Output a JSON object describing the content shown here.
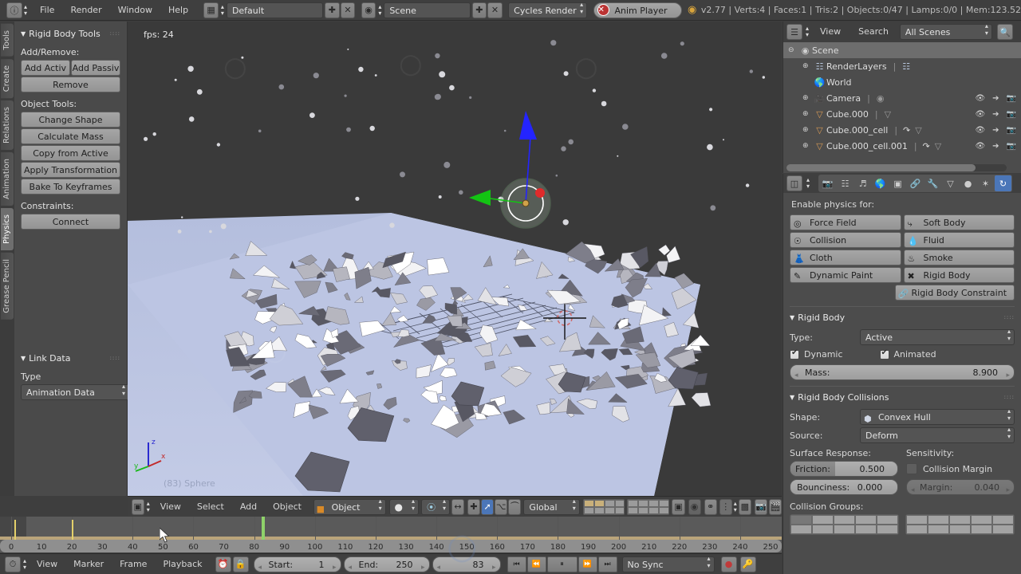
{
  "topbar": {
    "editor_icon": "info-editor-icon",
    "menus": [
      "File",
      "Render",
      "Window",
      "Help"
    ],
    "screen_layout": {
      "icon": "screen-layout-icon",
      "value": "Default",
      "add": "+",
      "remove": "×"
    },
    "scene": {
      "icon": "scene-icon",
      "value": "Scene",
      "add": "+",
      "remove": "×"
    },
    "engine": {
      "value": "Cycles Render"
    },
    "anim_player": {
      "label": "Anim Player",
      "close": "×"
    },
    "status": "v2.77 | Verts:4 | Faces:1 | Tris:2 | Objects:0/47 | Lamps:0/0 | Mem:123.52"
  },
  "toolshelf": {
    "tabs": [
      {
        "label": "Tools",
        "active": false
      },
      {
        "label": "Create",
        "active": false
      },
      {
        "label": "Relations",
        "active": false
      },
      {
        "label": "Animation",
        "active": false
      },
      {
        "label": "Physics",
        "active": true
      },
      {
        "label": "Grease Pencil",
        "active": false
      }
    ],
    "panel_rigid_body_tools": {
      "title": "Rigid Body Tools",
      "sections": [
        {
          "label": "Add/Remove:",
          "rows": [
            [
              "Add Activ",
              "Add Passiv"
            ],
            [
              "Remove"
            ]
          ]
        },
        {
          "label": "Object Tools:",
          "rows": [
            [
              "Change Shape"
            ],
            [
              "Calculate Mass"
            ],
            [
              "Copy from Active"
            ],
            [
              "Apply Transformation"
            ],
            [
              "Bake To Keyframes"
            ]
          ]
        },
        {
          "label": "Constraints:",
          "rows": [
            [
              "Connect"
            ]
          ]
        }
      ]
    },
    "panel_link_data": {
      "title": "Link Data",
      "type_label": "Type",
      "type_value": "Animation Data"
    }
  },
  "viewport": {
    "fps": "fps: 24",
    "active_object_label": "(83) Sphere",
    "axis_gizmo": {
      "x": "x",
      "y": "y",
      "z": "z"
    },
    "colors": {
      "ground": "#b9c2e0",
      "background": "#3a3a3a",
      "debris_light": "#f2f2f2",
      "debris_dark": "#6e6e78"
    },
    "header": {
      "editor_icon": "3d-view-editor-icon",
      "menus": [
        "View",
        "Select",
        "Add",
        "Object"
      ],
      "mode": "Object Mode",
      "shading": "solid-shading-icon",
      "pivot": "pivot-median-icon",
      "manipulator_axes": [
        "translate-manipulator-icon",
        "rotate-manipulator-icon",
        "scale-manipulator-icon"
      ],
      "transform_orientation": "Global",
      "layers": "layer-grid",
      "extras": [
        "render-opengl-icon",
        "render-opengl-anim-icon"
      ]
    }
  },
  "outliner": {
    "header": {
      "editor_icon": "outliner-editor-icon",
      "menus": [
        "View",
        "Search"
      ],
      "display_mode": "All Scenes",
      "search_icon": "search-icon"
    },
    "rows": [
      {
        "indent": 0,
        "expander": "⊖",
        "icon": "scene-icon",
        "label": "Scene",
        "selected": true,
        "extra": [],
        "actions": false
      },
      {
        "indent": 1,
        "expander": "⊕",
        "icon": "renderlayers-icon",
        "label": "RenderLayers",
        "selected": false,
        "extra": [
          "renderlayers-data-icon"
        ],
        "actions": false
      },
      {
        "indent": 1,
        "expander": "",
        "icon": "world-icon",
        "label": "World",
        "selected": false,
        "extra": [],
        "actions": false
      },
      {
        "indent": 1,
        "expander": "⊕",
        "icon": "camera-icon",
        "label": "Camera",
        "selected": false,
        "extra": [
          "camera-data-icon"
        ],
        "actions": true
      },
      {
        "indent": 1,
        "expander": "⊕",
        "icon": "mesh-icon",
        "label": "Cube.000",
        "selected": false,
        "extra": [
          "mesh-data-icon"
        ],
        "actions": true
      },
      {
        "indent": 1,
        "expander": "⊕",
        "icon": "mesh-icon",
        "label": "Cube.000_cell",
        "selected": false,
        "extra": [
          "modifier-icon",
          "mesh-data-icon"
        ],
        "actions": true
      },
      {
        "indent": 1,
        "expander": "⊕",
        "icon": "mesh-icon",
        "label": "Cube.000_cell.001",
        "selected": false,
        "extra": [
          "modifier-icon",
          "mesh-data-icon"
        ],
        "actions": true
      }
    ],
    "row_actions": [
      "eye-icon",
      "cursor-arrow-icon",
      "camera-render-icon"
    ]
  },
  "properties": {
    "header": {
      "editor_icon": "properties-editor-icon",
      "tabs": [
        {
          "name": "render-tab",
          "icon": "📷",
          "active": false
        },
        {
          "name": "render-layers-tab",
          "icon": "❐",
          "active": false
        },
        {
          "name": "scene-tab",
          "icon": "♪",
          "active": false
        },
        {
          "name": "world-tab",
          "icon": "◐",
          "active": false
        },
        {
          "name": "object-tab",
          "icon": "⬛",
          "active": false
        },
        {
          "name": "constraints-tab",
          "icon": "⚭",
          "active": false
        },
        {
          "name": "modifiers-tab",
          "icon": "🔧",
          "active": false
        },
        {
          "name": "data-tab",
          "icon": "▽",
          "active": false
        },
        {
          "name": "material-tab",
          "icon": "●",
          "active": false
        },
        {
          "name": "texture-tab",
          "icon": "✦",
          "active": false
        },
        {
          "name": "physics-tab",
          "icon": "↻",
          "active": true
        }
      ]
    },
    "enable_physics_label": "Enable physics for:",
    "physics_buttons": [
      {
        "label": "Force Field",
        "icon": "force-field-icon"
      },
      {
        "label": "Soft Body",
        "icon": "soft-body-icon"
      },
      {
        "label": "Collision",
        "icon": "collision-icon"
      },
      {
        "label": "Fluid",
        "icon": "fluid-icon"
      },
      {
        "label": "Cloth",
        "icon": "cloth-icon"
      },
      {
        "label": "Smoke",
        "icon": "smoke-icon"
      },
      {
        "label": "Dynamic Paint",
        "icon": "dynamic-paint-icon"
      },
      {
        "label": "Rigid Body",
        "icon": "rigid-body-icon"
      }
    ],
    "rigid_body_constraint_button": {
      "label": "Rigid Body Constraint",
      "icon": "constraint-icon"
    },
    "rigid_body": {
      "title": "Rigid Body",
      "type_label": "Type:",
      "type_value": "Active",
      "dynamic": {
        "label": "Dynamic",
        "checked": true
      },
      "animated": {
        "label": "Animated",
        "checked": true
      },
      "mass_label": "Mass:",
      "mass_value": "8.900"
    },
    "rigid_body_collisions": {
      "title": "Rigid Body Collisions",
      "shape_label": "Shape:",
      "shape_value": "Convex Hull",
      "shape_icon": "convex-hull-icon",
      "source_label": "Source:",
      "source_value": "Deform",
      "surface_response_label": "Surface Response:",
      "sensitivity_label": "Sensitivity:",
      "friction_label": "Friction:",
      "friction_value": "0.500",
      "bounciness_label": "Bounciness:",
      "bounciness_value": "0.000",
      "collision_margin": {
        "label": "Collision Margin",
        "checked": false
      },
      "margin_label": "Margin:",
      "margin_value": "0.040",
      "collision_groups_label": "Collision Groups:"
    }
  },
  "timeline": {
    "ticks": [
      "0",
      "10",
      "20",
      "30",
      "40",
      "50",
      "60",
      "70",
      "80",
      "90",
      "100",
      "110",
      "120",
      "130",
      "140",
      "150",
      "160",
      "170",
      "180",
      "190",
      "200",
      "210",
      "220",
      "230",
      "240",
      "250"
    ],
    "keyframes": [
      1,
      20
    ],
    "current_frame": 83,
    "header": {
      "editor_icon": "timeline-editor-icon",
      "menus": [
        "View",
        "Marker",
        "Frame",
        "Playback"
      ],
      "auto_key_icon": "record-auto-key-icon",
      "lock_icon": "lock-icon",
      "start_label": "Start:",
      "start_value": "1",
      "end_label": "End:",
      "end_value": "250",
      "frame_value": "83",
      "transport": [
        "jump-start-icon",
        "play-reverse-icon",
        "pause-icon",
        "play-forward-icon",
        "jump-end-icon"
      ],
      "sync_mode": "No Sync",
      "record_icon": "record-icon",
      "keying_set_icon": "keying-set-icon"
    }
  }
}
